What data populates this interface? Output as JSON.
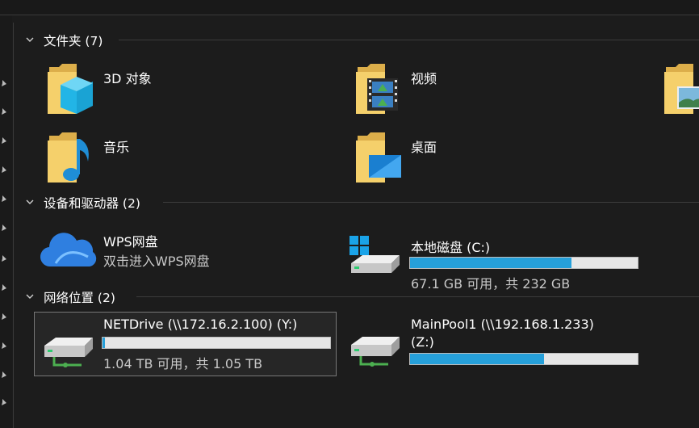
{
  "groups": {
    "folders": {
      "title": "文件夹 (7)"
    },
    "devices": {
      "title": "设备和驱动器 (2)"
    },
    "network": {
      "title": "网络位置 (2)"
    }
  },
  "folders": [
    {
      "label": "3D 对象",
      "icon": "3d-objects-folder-icon"
    },
    {
      "label": "视频",
      "icon": "videos-folder-icon"
    },
    {
      "label": "",
      "icon": "pictures-folder-icon"
    },
    {
      "label": "音乐",
      "icon": "music-folder-icon"
    },
    {
      "label": "桌面",
      "icon": "desktop-folder-icon"
    }
  ],
  "devices": [
    {
      "label": "WPS网盘",
      "sub": "双击进入WPS网盘",
      "icon": "wps-cloud-icon"
    },
    {
      "label": "本地磁盘 (C:)",
      "sub": "67.1 GB 可用，共 232 GB",
      "usage_fraction": 0.71,
      "icon": "windows-drive-icon"
    }
  ],
  "network": [
    {
      "label": "NETDrive (\\\\172.16.2.100) (Y:)",
      "sub": "1.04 TB 可用，共 1.05 TB",
      "usage_fraction": 0.01,
      "icon": "network-drive-icon"
    },
    {
      "label": "MainPool1 (\\\\192.168.1.233)",
      "label2": "(Z:)",
      "usage_fraction": 0.59,
      "icon": "network-drive-icon"
    }
  ],
  "colors": {
    "background": "#1c1c1c",
    "bar_fill": "#26a0da",
    "bar_track": "#e6e6e6",
    "folder": "#f5d06b"
  }
}
